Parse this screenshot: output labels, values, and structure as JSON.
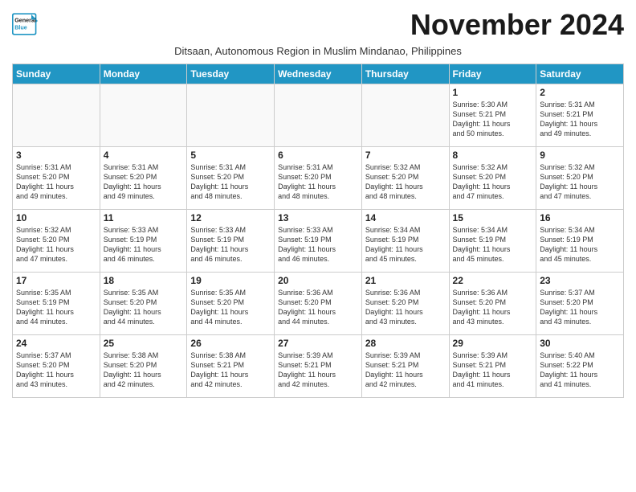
{
  "header": {
    "logo_line1": "General",
    "logo_line2": "Blue",
    "month": "November 2024",
    "subtitle": "Ditsaan, Autonomous Region in Muslim Mindanao, Philippines"
  },
  "weekdays": [
    "Sunday",
    "Monday",
    "Tuesday",
    "Wednesday",
    "Thursday",
    "Friday",
    "Saturday"
  ],
  "weeks": [
    [
      {
        "day": "",
        "info": ""
      },
      {
        "day": "",
        "info": ""
      },
      {
        "day": "",
        "info": ""
      },
      {
        "day": "",
        "info": ""
      },
      {
        "day": "",
        "info": ""
      },
      {
        "day": "1",
        "info": "Sunrise: 5:30 AM\nSunset: 5:21 PM\nDaylight: 11 hours\nand 50 minutes."
      },
      {
        "day": "2",
        "info": "Sunrise: 5:31 AM\nSunset: 5:21 PM\nDaylight: 11 hours\nand 49 minutes."
      }
    ],
    [
      {
        "day": "3",
        "info": "Sunrise: 5:31 AM\nSunset: 5:20 PM\nDaylight: 11 hours\nand 49 minutes."
      },
      {
        "day": "4",
        "info": "Sunrise: 5:31 AM\nSunset: 5:20 PM\nDaylight: 11 hours\nand 49 minutes."
      },
      {
        "day": "5",
        "info": "Sunrise: 5:31 AM\nSunset: 5:20 PM\nDaylight: 11 hours\nand 48 minutes."
      },
      {
        "day": "6",
        "info": "Sunrise: 5:31 AM\nSunset: 5:20 PM\nDaylight: 11 hours\nand 48 minutes."
      },
      {
        "day": "7",
        "info": "Sunrise: 5:32 AM\nSunset: 5:20 PM\nDaylight: 11 hours\nand 48 minutes."
      },
      {
        "day": "8",
        "info": "Sunrise: 5:32 AM\nSunset: 5:20 PM\nDaylight: 11 hours\nand 47 minutes."
      },
      {
        "day": "9",
        "info": "Sunrise: 5:32 AM\nSunset: 5:20 PM\nDaylight: 11 hours\nand 47 minutes."
      }
    ],
    [
      {
        "day": "10",
        "info": "Sunrise: 5:32 AM\nSunset: 5:20 PM\nDaylight: 11 hours\nand 47 minutes."
      },
      {
        "day": "11",
        "info": "Sunrise: 5:33 AM\nSunset: 5:19 PM\nDaylight: 11 hours\nand 46 minutes."
      },
      {
        "day": "12",
        "info": "Sunrise: 5:33 AM\nSunset: 5:19 PM\nDaylight: 11 hours\nand 46 minutes."
      },
      {
        "day": "13",
        "info": "Sunrise: 5:33 AM\nSunset: 5:19 PM\nDaylight: 11 hours\nand 46 minutes."
      },
      {
        "day": "14",
        "info": "Sunrise: 5:34 AM\nSunset: 5:19 PM\nDaylight: 11 hours\nand 45 minutes."
      },
      {
        "day": "15",
        "info": "Sunrise: 5:34 AM\nSunset: 5:19 PM\nDaylight: 11 hours\nand 45 minutes."
      },
      {
        "day": "16",
        "info": "Sunrise: 5:34 AM\nSunset: 5:19 PM\nDaylight: 11 hours\nand 45 minutes."
      }
    ],
    [
      {
        "day": "17",
        "info": "Sunrise: 5:35 AM\nSunset: 5:19 PM\nDaylight: 11 hours\nand 44 minutes."
      },
      {
        "day": "18",
        "info": "Sunrise: 5:35 AM\nSunset: 5:20 PM\nDaylight: 11 hours\nand 44 minutes."
      },
      {
        "day": "19",
        "info": "Sunrise: 5:35 AM\nSunset: 5:20 PM\nDaylight: 11 hours\nand 44 minutes."
      },
      {
        "day": "20",
        "info": "Sunrise: 5:36 AM\nSunset: 5:20 PM\nDaylight: 11 hours\nand 44 minutes."
      },
      {
        "day": "21",
        "info": "Sunrise: 5:36 AM\nSunset: 5:20 PM\nDaylight: 11 hours\nand 43 minutes."
      },
      {
        "day": "22",
        "info": "Sunrise: 5:36 AM\nSunset: 5:20 PM\nDaylight: 11 hours\nand 43 minutes."
      },
      {
        "day": "23",
        "info": "Sunrise: 5:37 AM\nSunset: 5:20 PM\nDaylight: 11 hours\nand 43 minutes."
      }
    ],
    [
      {
        "day": "24",
        "info": "Sunrise: 5:37 AM\nSunset: 5:20 PM\nDaylight: 11 hours\nand 43 minutes."
      },
      {
        "day": "25",
        "info": "Sunrise: 5:38 AM\nSunset: 5:20 PM\nDaylight: 11 hours\nand 42 minutes."
      },
      {
        "day": "26",
        "info": "Sunrise: 5:38 AM\nSunset: 5:21 PM\nDaylight: 11 hours\nand 42 minutes."
      },
      {
        "day": "27",
        "info": "Sunrise: 5:39 AM\nSunset: 5:21 PM\nDaylight: 11 hours\nand 42 minutes."
      },
      {
        "day": "28",
        "info": "Sunrise: 5:39 AM\nSunset: 5:21 PM\nDaylight: 11 hours\nand 42 minutes."
      },
      {
        "day": "29",
        "info": "Sunrise: 5:39 AM\nSunset: 5:21 PM\nDaylight: 11 hours\nand 41 minutes."
      },
      {
        "day": "30",
        "info": "Sunrise: 5:40 AM\nSunset: 5:22 PM\nDaylight: 11 hours\nand 41 minutes."
      }
    ]
  ]
}
